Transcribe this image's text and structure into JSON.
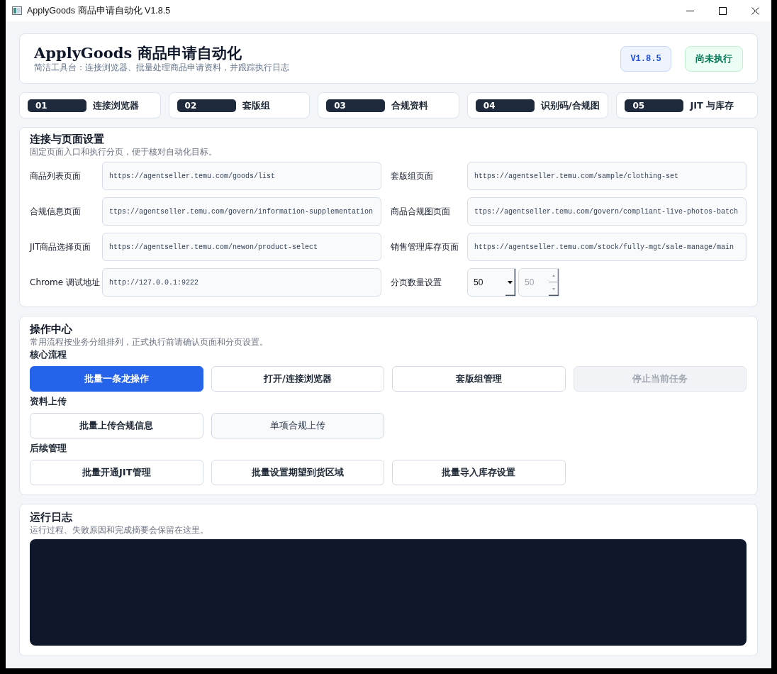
{
  "window": {
    "title": "ApplyGoods 商品申请自动化 V1.8.5"
  },
  "header": {
    "title": "ApplyGoods 商品申请自动化",
    "subtitle": "简洁工具台：连接浏览器、批量处理商品申请资料，并跟踪执行日志",
    "version": "V1.8.5",
    "status": "尚未执行"
  },
  "steps": [
    {
      "number": "01",
      "label": "连接浏览器"
    },
    {
      "number": "02",
      "label": "套版组"
    },
    {
      "number": "03",
      "label": "合规资料"
    },
    {
      "number": "04",
      "label": "识别码/合规图"
    },
    {
      "number": "05",
      "label": "JIT 与库存"
    }
  ],
  "settings": {
    "title": "连接与页面设置",
    "subtitle": "固定页面入口和执行分页，便于核对自动化目标。",
    "fields": [
      {
        "label": "商品列表页面",
        "kind": "url",
        "value": "https://agentseller.temu.com/goods/list"
      },
      {
        "label": "套版组页面",
        "kind": "url",
        "value": "https://agentseller.temu.com/sample/clothing-set"
      },
      {
        "label": "合规信息页面",
        "kind": "url",
        "value": "ttps://agentseller.temu.com/govern/information-supplementation"
      },
      {
        "label": "商品合规图页面",
        "kind": "url",
        "value": "ttps://agentseller.temu.com/govern/compliant-live-photos-batch"
      },
      {
        "label": "JIT商品选择页面",
        "kind": "url",
        "value": "https://agentseller.temu.com/newon/product-select"
      },
      {
        "label": "销售管理库存页面",
        "kind": "url",
        "value": "https://agentseller.temu.com/stock/fully-mgt/sale-manage/main"
      },
      {
        "label": "Chrome 调试地址",
        "kind": "url",
        "value": "http://127.0.0.1:9222"
      },
      {
        "label": "分页数量设置",
        "kind": "page_size",
        "select_value": "50",
        "spin_value": "50",
        "spin_disabled": true
      }
    ]
  },
  "operations": {
    "title": "操作中心",
    "subtitle": "常用流程按业务分组排列，正式执行前请确认页面和分页设置。",
    "groups": [
      {
        "title": "核心流程",
        "buttons": [
          {
            "label": "批量一条龙操作",
            "kind": "primary",
            "disabled": false
          },
          {
            "label": "打开/连接浏览器",
            "kind": "outline",
            "disabled": false
          },
          {
            "label": "套版组管理",
            "kind": "outline",
            "disabled": false
          },
          {
            "label": "停止当前任务",
            "kind": "outline",
            "disabled": true
          }
        ]
      },
      {
        "title": "资料上传",
        "buttons": [
          {
            "label": "批量上传合规信息",
            "kind": "outline",
            "disabled": false
          },
          {
            "label": "单项合规上传",
            "kind": "soft",
            "disabled": false
          }
        ]
      },
      {
        "title": "后续管理",
        "buttons": [
          {
            "label": "批量开通JIT管理",
            "kind": "outline",
            "disabled": false
          },
          {
            "label": "批量设置期望到货区域",
            "kind": "outline",
            "disabled": false
          },
          {
            "label": "批量导入库存设置",
            "kind": "outline",
            "disabled": false
          }
        ]
      }
    ]
  },
  "log": {
    "title": "运行日志",
    "subtitle": "运行过程、失败原因和完成摘要会保留在这里。"
  }
}
